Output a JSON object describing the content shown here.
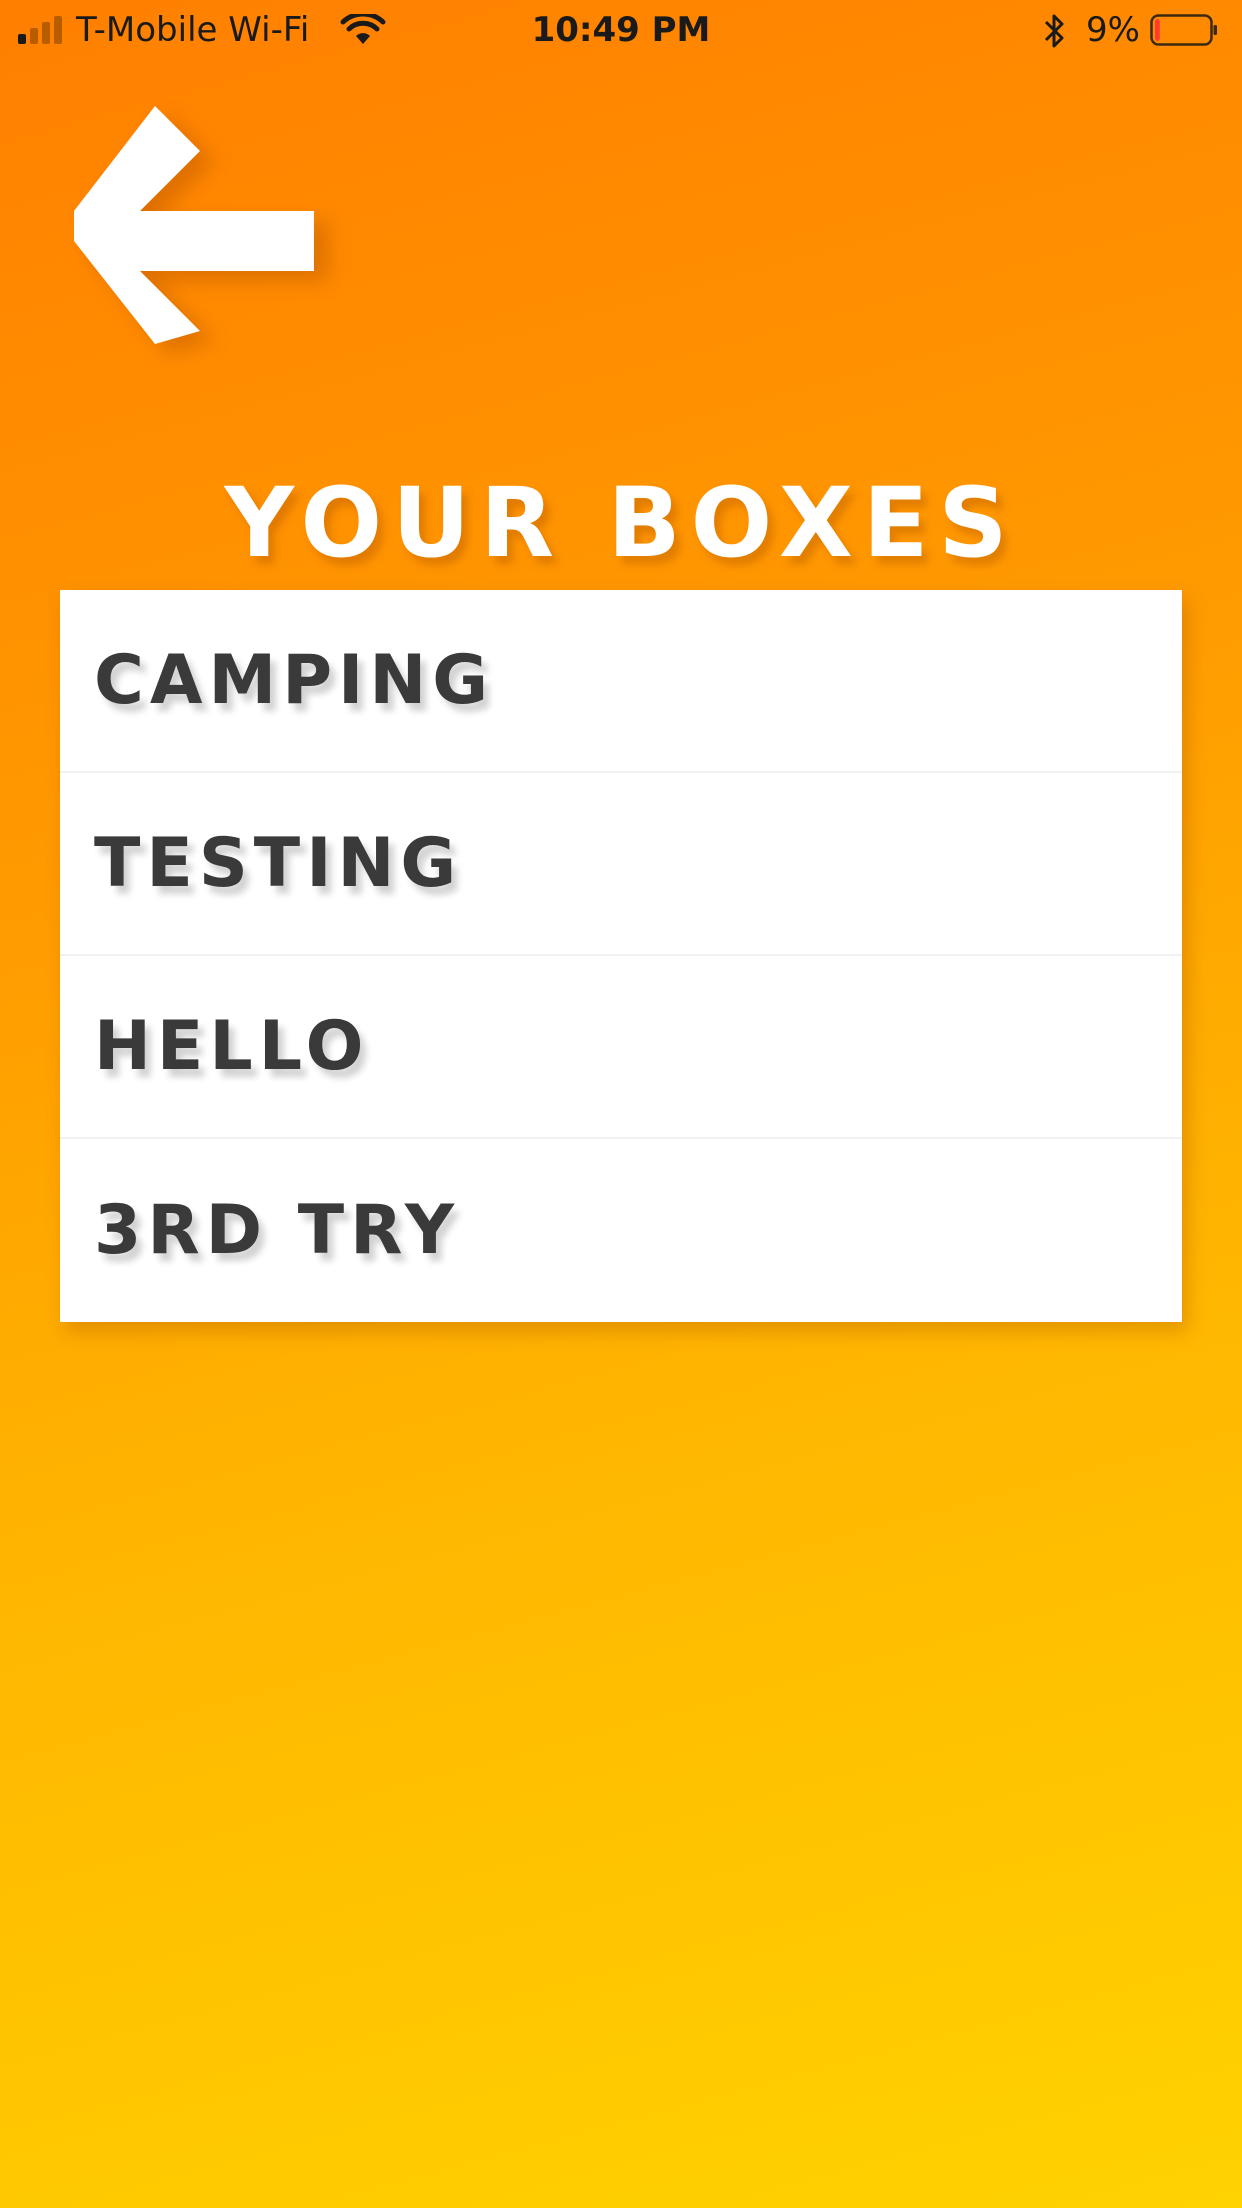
{
  "status_bar": {
    "carrier": "T-Mobile Wi-Fi",
    "time": "10:49 PM",
    "battery_percent": "9%",
    "signal_icon": "cellular-signal-icon",
    "wifi_icon": "wifi-icon",
    "bluetooth_icon": "bluetooth-icon",
    "battery_icon": "battery-low-icon",
    "battery_level": 0.09
  },
  "header": {
    "back_icon": "arrow-left-icon",
    "title": "YOUR BOXES"
  },
  "boxes": [
    {
      "label": "CAMPING"
    },
    {
      "label": "TESTING"
    },
    {
      "label": "HELLO"
    },
    {
      "label": "3RD TRY"
    }
  ],
  "colors": {
    "gradient_top": "#ff7f00",
    "gradient_bottom": "#ffd300",
    "list_text": "#3a3a3a",
    "title_text": "#ffffff",
    "battery_low": "#ff3b30"
  }
}
